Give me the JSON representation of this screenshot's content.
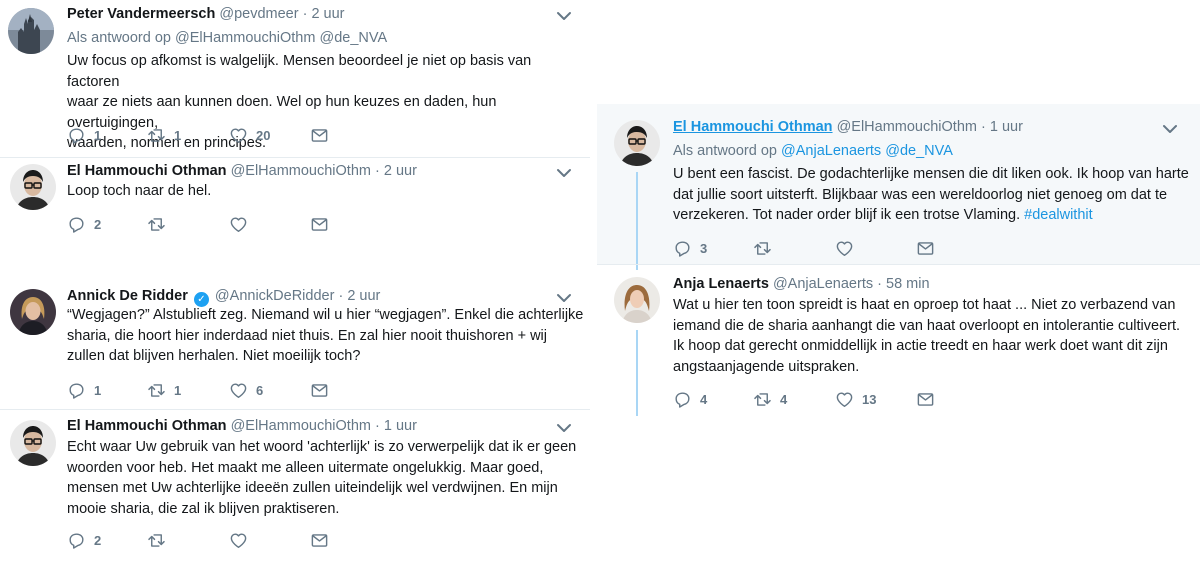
{
  "left_column": [
    {
      "name": "Peter Vandermeersch",
      "handle": "@pevdmeer",
      "separator": "·",
      "time": "2 uur",
      "reply_label": "Als antwoord op",
      "reply_mentions": [
        "@ElHammouchiOthm",
        "@de_NVA"
      ],
      "text": "Uw focus op afkomst is walgelijk. Mensen beoordeel je niet op basis van factoren\nwaar ze niets aan kunnen doen. Wel op hun keuzes en daden, hun overtuigingen,\nwaarden, normen en principes.",
      "replies": "1",
      "retweets": "1",
      "likes": "20"
    },
    {
      "name": "El Hammouchi Othman",
      "handle": "@ElHammouchiOthm",
      "separator": "·",
      "time": "2 uur",
      "text": "Loop toch naar de hel.",
      "replies": "2",
      "retweets": "",
      "likes": ""
    },
    {
      "name": "Annick De Ridder",
      "handle": "@AnnickDeRidder",
      "separator": "·",
      "time": "2 uur",
      "text": "“Wegjagen?” Alstublieft zeg. Niemand wil u hier “wegjagen”. Enkel die achterlijke\nsharia, die hoort hier inderdaad niet thuis. En zal hier nooit thuishoren + wij\nzullen dat blijven herhalen. Niet moeilijk toch?",
      "replies": "1",
      "retweets": "1",
      "likes": "6"
    },
    {
      "name": "El Hammouchi Othman",
      "handle": "@ElHammouchiOthm",
      "separator": "·",
      "time": "1 uur",
      "text": "Echt waar Uw gebruik van het woord 'achterlijk' is zo verwerpelijk dat ik er geen\nwoorden voor heb. Het maakt me alleen uitermate ongelukkig. Maar goed,\nmensen met Uw achterlijke ideeën zullen uiteindelijk wel verdwijnen. En mijn\nmooie sharia, die zal ik blijven praktiseren.",
      "replies": "2",
      "retweets": "",
      "likes": ""
    }
  ],
  "right_column": [
    {
      "name": "El Hammouchi Othman",
      "handle": "@ElHammouchiOthm",
      "separator": "·",
      "time": "1 uur",
      "reply_label": "Als antwoord op",
      "reply_mentions": [
        "@AnjaLenaerts",
        "@de_NVA"
      ],
      "text_main": "U bent een fascist. De godachterlijke mensen die dit liken ook. Ik hoop van harte\ndat jullie soort uitsterft. Blijkbaar was een wereldoorlog niet genoeg om dat te\nverzekeren. Tot nader order blijf ik een trotse Vlaming. ",
      "hashtag": "#dealwithit",
      "replies": "3",
      "retweets": "",
      "likes": ""
    },
    {
      "name": "Anja Lenaerts",
      "handle": "@AnjaLenaerts",
      "separator": "·",
      "time": "58 min",
      "text": "Wat u hier ten toon spreidt is haat en oproep tot haat ... Niet zo verbazend van\niemand die de sharia aanhangt die van haat overloopt en intolerantie cultiveert.\nIk hoop dat gerecht onmiddellijk in actie treedt en haar werk doet want dit zijn\nangstaanjagende uitspraken.",
      "replies": "4",
      "retweets": "4",
      "likes": "13"
    }
  ],
  "icons": {
    "reply": "reply-icon",
    "retweet": "retweet-icon",
    "like": "heart-icon",
    "dm": "envelope-icon",
    "menu": "chevron-down-icon"
  },
  "colors": {
    "link_blue": "#1b95e0",
    "muted_grey": "#657786",
    "thread_line": "#a9d6f5",
    "highlight_bg": "#f5f8fa",
    "verified_blue": "#1da1f2"
  }
}
